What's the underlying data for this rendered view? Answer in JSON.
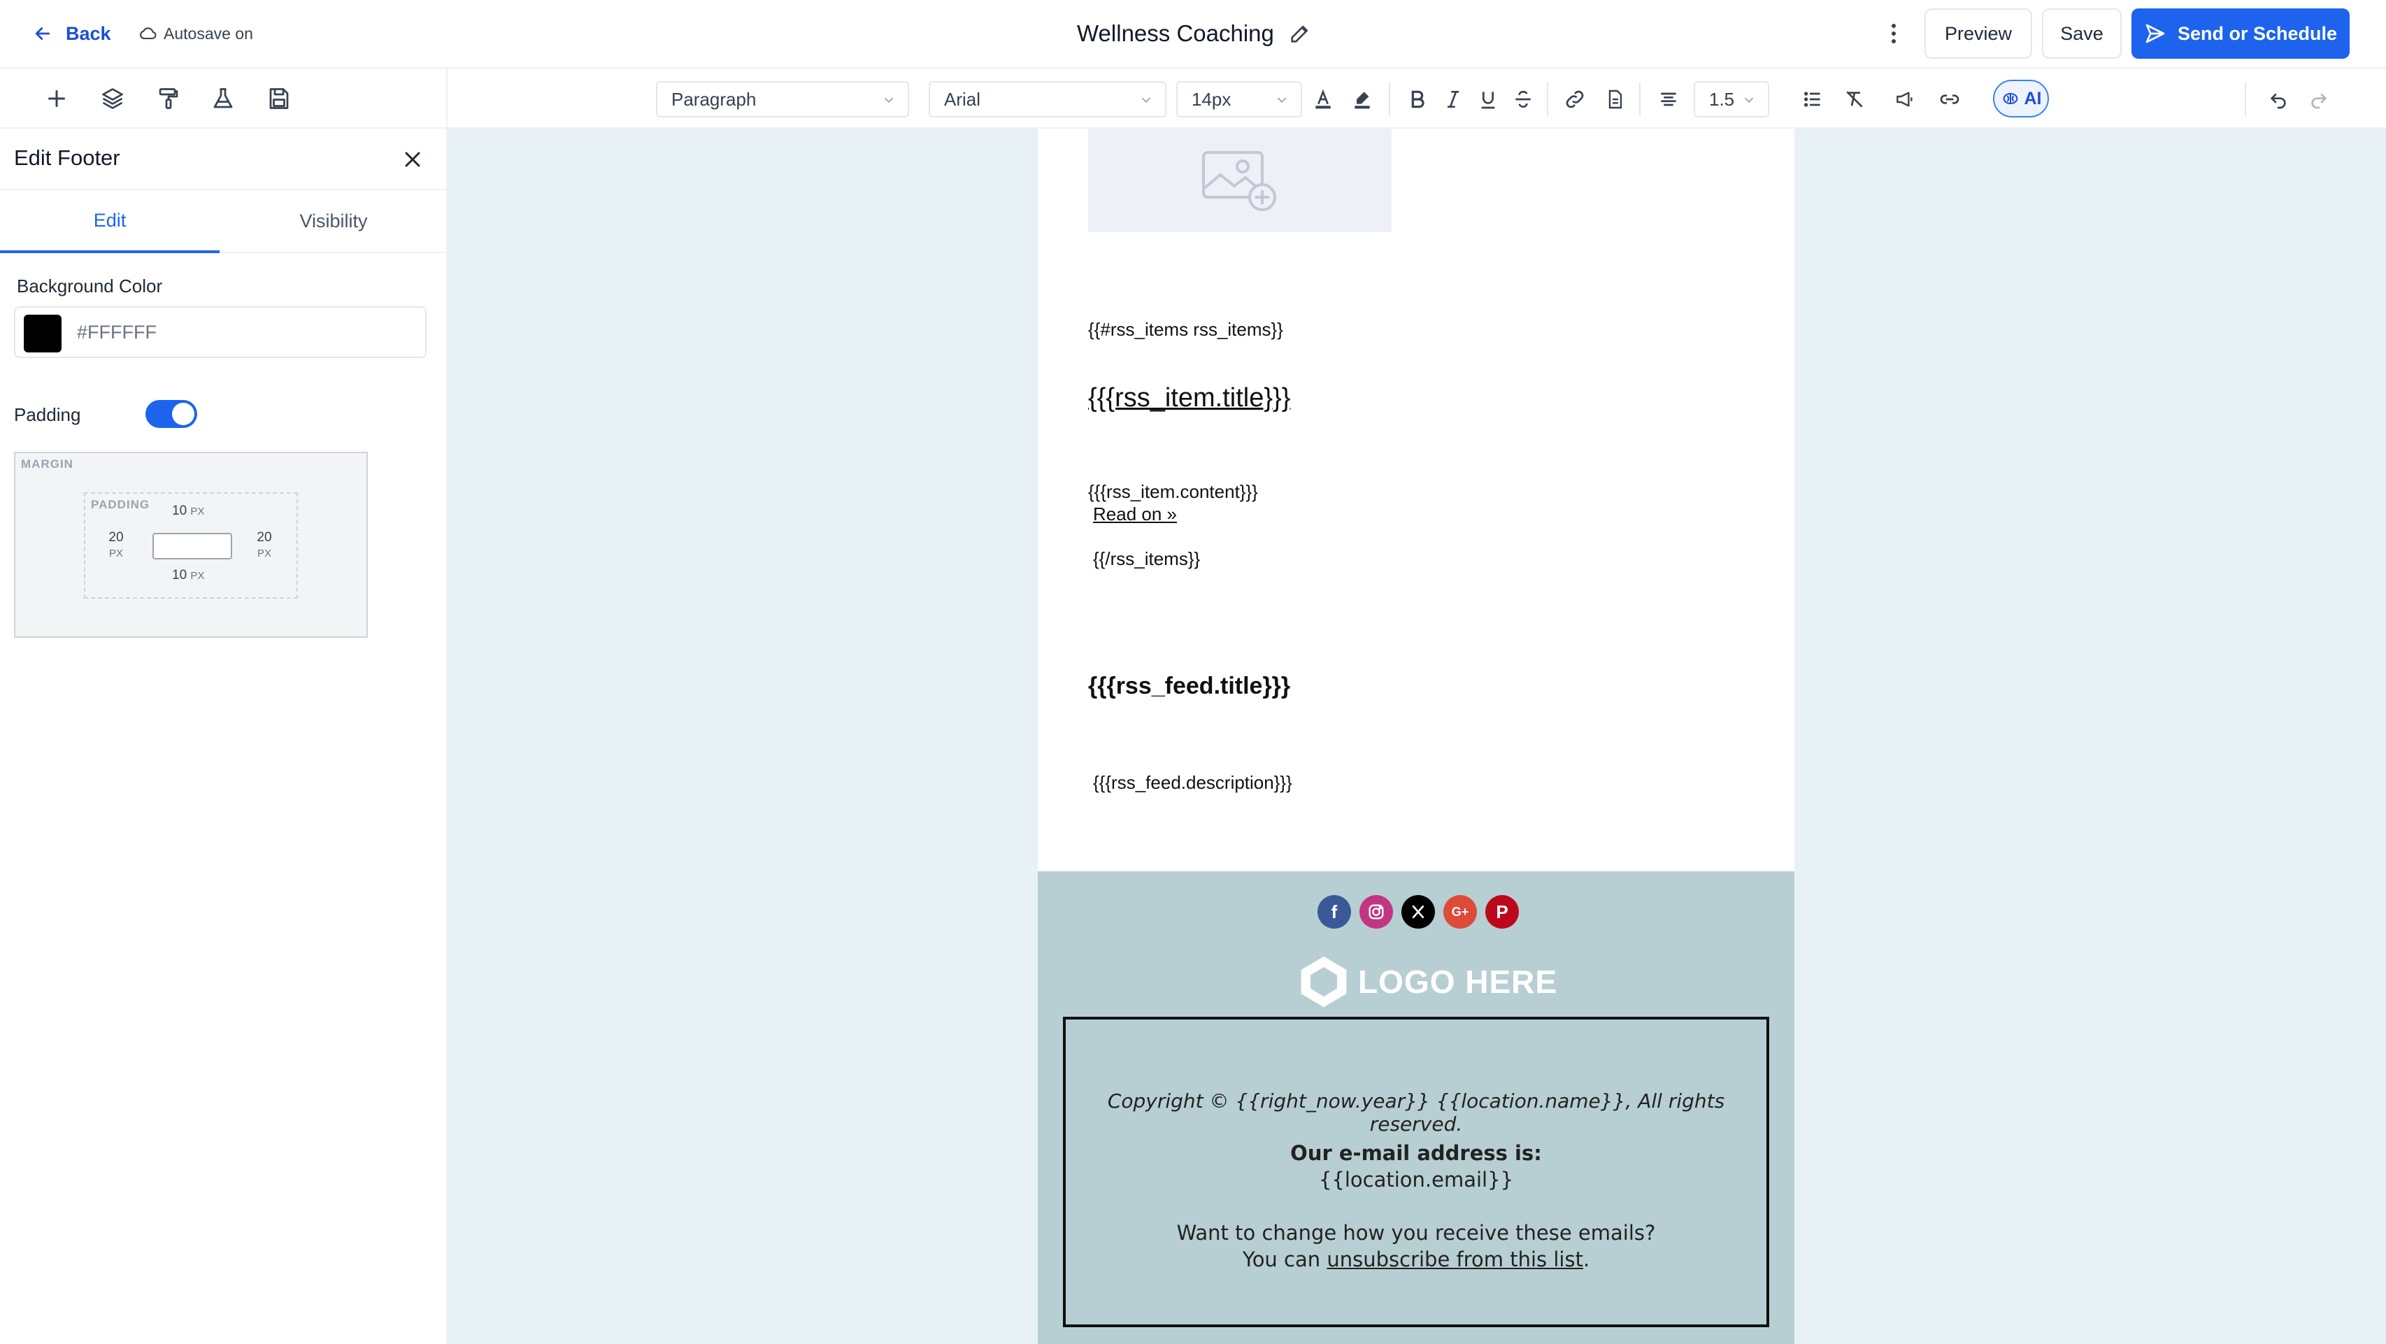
{
  "header": {
    "back_label": "Back",
    "autosave_label": "Autosave on",
    "doc_title": "Wellness Coaching",
    "preview_label": "Preview",
    "save_label": "Save",
    "send_label": "Send or Schedule"
  },
  "toolbar": {
    "block_style": "Paragraph",
    "font_family": "Arial",
    "font_size": "14px",
    "line_height": "1.5",
    "ai_label": "AI"
  },
  "panel": {
    "title": "Edit Footer",
    "tabs": [
      {
        "label": "Edit",
        "active": true
      },
      {
        "label": "Visibility",
        "active": false
      }
    ],
    "background_label": "Background Color",
    "background_value": "#FFFFFF",
    "background_swatch": "#000000",
    "padding_label": "Padding",
    "padding_enabled": true,
    "margin_label": "MARGIN",
    "padding_box_label": "PADDING",
    "padding_top": "10",
    "padding_bottom": "10",
    "padding_left": "20",
    "padding_right": "20",
    "unit": "PX"
  },
  "email": {
    "rss_items_open": "{{#rss_items rss_items}}",
    "rss_item_title": "{{{rss_item.title}}}",
    "rss_item_content": "{{{rss_item.content}}}",
    "read_on": "Read on »",
    "rss_items_close": "{{/rss_items}}",
    "rss_feed_title": "{{{rss_feed.title}}}",
    "rss_feed_description": "{{{rss_feed.description}}}",
    "footer": {
      "logo_text": "LOGO HERE",
      "background": "#b7cfd2",
      "copyright": "Copyright © {{right_now.year}}  {{location.name}}, All rights reserved.",
      "address_label": "Our e-mail address is:",
      "address_value": "{{location.email}}",
      "change_text": "Want to change how you receive these emails?",
      "unsub_prefix": "You can ",
      "unsub_link": "unsubscribe from this list",
      "unsub_suffix": "."
    }
  },
  "colors": {
    "primary": "#1d63ed",
    "canvas_bg": "#e8f1f5"
  }
}
